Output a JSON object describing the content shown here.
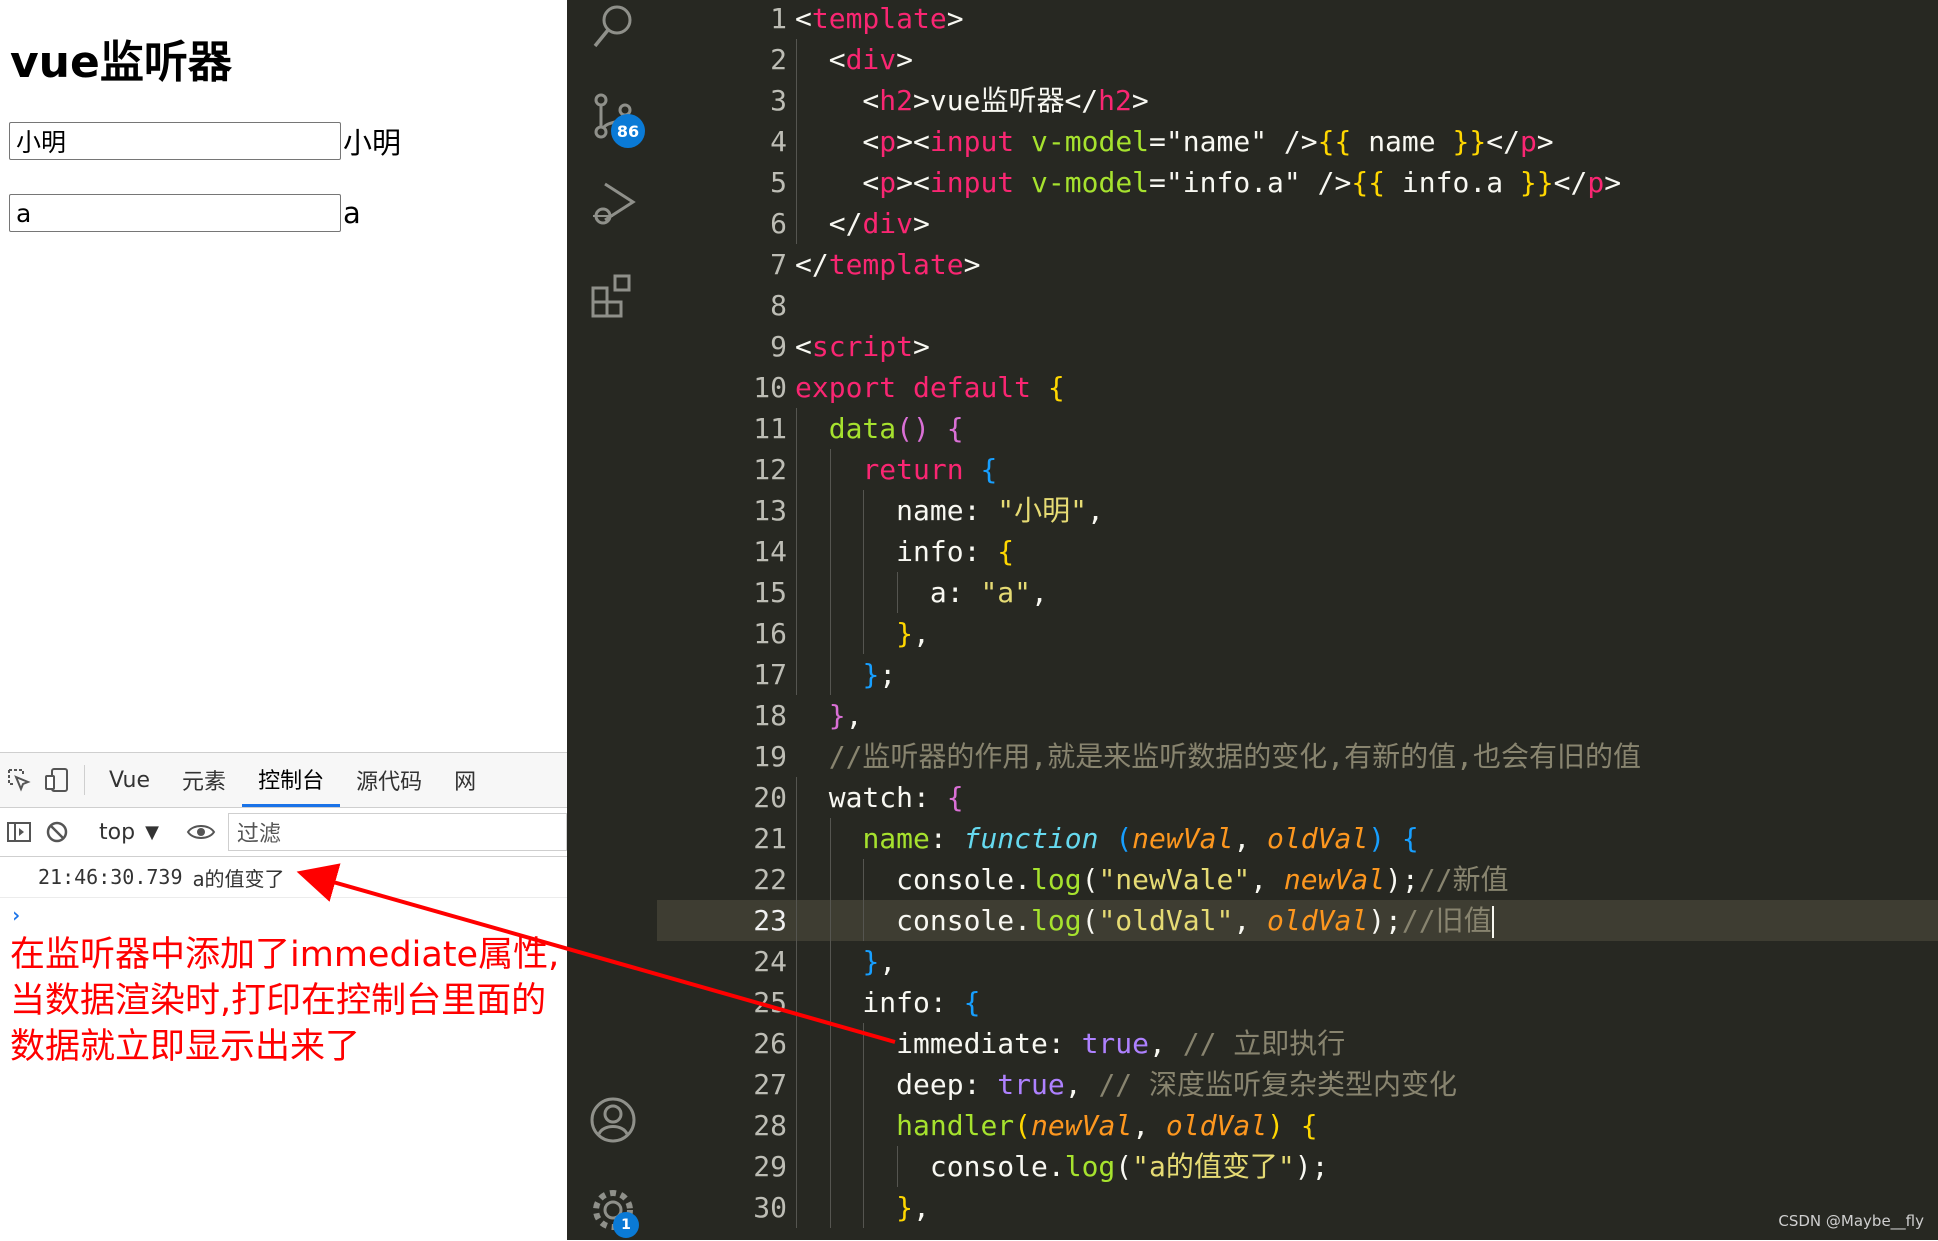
{
  "browser": {
    "heading": "vue监听器",
    "field1": {
      "value": "小明",
      "echo": "小明"
    },
    "field2": {
      "value": "a",
      "echo": "a"
    }
  },
  "devtools": {
    "tabs": [
      "Vue",
      "元素",
      "控制台",
      "源代码",
      "网"
    ],
    "active_tab": "控制台",
    "context": "top",
    "filter_placeholder": "过滤",
    "log": {
      "time": "21:46:30.739",
      "message": "a的值变了"
    },
    "prompt": "›"
  },
  "annotation": [
    "在监听器中添加了immediate属性,",
    "当数据渲染时,打印在控制台里面的",
    "数据就立即显示出来了"
  ],
  "vscode": {
    "scm_badge": "86",
    "settings_badge": "1",
    "current_line": 23,
    "lines": [
      [
        [
          "<",
          "t-punc"
        ],
        [
          "template",
          "t-tag"
        ],
        [
          ">",
          "t-punc"
        ]
      ],
      [
        [
          "  <",
          "t-punc"
        ],
        [
          "div",
          "t-tag"
        ],
        [
          ">",
          "t-punc"
        ]
      ],
      [
        [
          "    <",
          "t-punc"
        ],
        [
          "h2",
          "t-tag"
        ],
        [
          ">vue监听器</",
          "t-punc"
        ],
        [
          "h2",
          "t-tag"
        ],
        [
          ">",
          "t-punc"
        ]
      ],
      [
        [
          "    <",
          "t-punc"
        ],
        [
          "p",
          "t-tag"
        ],
        [
          "><",
          "t-punc"
        ],
        [
          "input",
          "t-tag"
        ],
        [
          " ",
          "t-punc"
        ],
        [
          "v-model",
          "t-fn"
        ],
        [
          "=\"name\" />",
          "t-punc"
        ],
        [
          "{{",
          "t-brace-y"
        ],
        [
          " name ",
          "t-punc"
        ],
        [
          "}}",
          "t-brace-y"
        ],
        [
          "</",
          "t-punc"
        ],
        [
          "p",
          "t-tag"
        ],
        [
          ">",
          "t-punc"
        ]
      ],
      [
        [
          "    <",
          "t-punc"
        ],
        [
          "p",
          "t-tag"
        ],
        [
          "><",
          "t-punc"
        ],
        [
          "input",
          "t-tag"
        ],
        [
          " ",
          "t-punc"
        ],
        [
          "v-model",
          "t-fn"
        ],
        [
          "=\"info.a\" />",
          "t-punc"
        ],
        [
          "{{",
          "t-brace-y"
        ],
        [
          " info.a ",
          "t-punc"
        ],
        [
          "}}",
          "t-brace-y"
        ],
        [
          "</",
          "t-punc"
        ],
        [
          "p",
          "t-tag"
        ],
        [
          ">",
          "t-punc"
        ]
      ],
      [
        [
          "  </",
          "t-punc"
        ],
        [
          "div",
          "t-tag"
        ],
        [
          ">",
          "t-punc"
        ]
      ],
      [
        [
          "</",
          "t-punc"
        ],
        [
          "template",
          "t-tag"
        ],
        [
          ">",
          "t-punc"
        ]
      ],
      [],
      [
        [
          "<",
          "t-punc"
        ],
        [
          "script",
          "t-tag"
        ],
        [
          ">",
          "t-punc"
        ]
      ],
      [
        [
          "export",
          "t-kw"
        ],
        [
          " ",
          "t-punc"
        ],
        [
          "default",
          "t-kw"
        ],
        [
          " ",
          "t-punc"
        ],
        [
          "{",
          "t-brace-y"
        ]
      ],
      [
        [
          "  ",
          "t-punc"
        ],
        [
          "data",
          "t-fn"
        ],
        [
          "()",
          "t-brace-p"
        ],
        [
          " ",
          "t-punc"
        ],
        [
          "{",
          "t-brace-p"
        ]
      ],
      [
        [
          "    ",
          "t-punc"
        ],
        [
          "return",
          "t-kw"
        ],
        [
          " ",
          "t-punc"
        ],
        [
          "{",
          "t-brace-b"
        ]
      ],
      [
        [
          "      name: ",
          "t-punc"
        ],
        [
          "\"小明\"",
          "t-str"
        ],
        [
          ",",
          "t-punc"
        ]
      ],
      [
        [
          "      info: ",
          "t-punc"
        ],
        [
          "{",
          "t-brace-y"
        ]
      ],
      [
        [
          "        a: ",
          "t-punc"
        ],
        [
          "\"a\"",
          "t-str"
        ],
        [
          ",",
          "t-punc"
        ]
      ],
      [
        [
          "      ",
          "t-punc"
        ],
        [
          "}",
          "t-brace-y"
        ],
        [
          ",",
          "t-punc"
        ]
      ],
      [
        [
          "    ",
          "t-punc"
        ],
        [
          "}",
          "t-brace-b"
        ],
        [
          ";",
          "t-punc"
        ]
      ],
      [
        [
          "  ",
          "t-punc"
        ],
        [
          "}",
          "t-brace-p"
        ],
        [
          ",",
          "t-punc"
        ]
      ],
      [
        [
          "  //监听器的作用,就是来监听数据的变化,有新的值,也会有旧的值",
          "t-cm"
        ]
      ],
      [
        [
          "  watch: ",
          "t-punc"
        ],
        [
          "{",
          "t-brace-p"
        ]
      ],
      [
        [
          "    ",
          "t-punc"
        ],
        [
          "name",
          "t-fn"
        ],
        [
          ": ",
          "t-punc"
        ],
        [
          "function",
          "t-stor"
        ],
        [
          " ",
          "t-punc"
        ],
        [
          "(",
          "t-brace-b"
        ],
        [
          "newVal",
          "t-param"
        ],
        [
          ", ",
          "t-punc"
        ],
        [
          "oldVal",
          "t-param"
        ],
        [
          ")",
          "t-brace-b"
        ],
        [
          " ",
          "t-punc"
        ],
        [
          "{",
          "t-brace-b"
        ]
      ],
      [
        [
          "      console.",
          "t-punc"
        ],
        [
          "log",
          "t-fn"
        ],
        [
          "(",
          "t-punc"
        ],
        [
          "\"newVale\"",
          "t-str"
        ],
        [
          ", ",
          "t-punc"
        ],
        [
          "newVal",
          "t-param"
        ],
        [
          ");",
          "t-punc"
        ],
        [
          "//新值",
          "t-cm"
        ]
      ],
      [
        [
          "      console.",
          "t-punc"
        ],
        [
          "log",
          "t-fn"
        ],
        [
          "(",
          "t-punc"
        ],
        [
          "\"oldVal\"",
          "t-str"
        ],
        [
          ", ",
          "t-punc"
        ],
        [
          "oldVal",
          "t-param"
        ],
        [
          ");",
          "t-punc"
        ],
        [
          "//旧值",
          "t-cm"
        ]
      ],
      [
        [
          "    ",
          "t-punc"
        ],
        [
          "}",
          "t-brace-b"
        ],
        [
          ",",
          "t-punc"
        ]
      ],
      [
        [
          "    info: ",
          "t-punc"
        ],
        [
          "{",
          "t-brace-b"
        ]
      ],
      [
        [
          "      immediate: ",
          "t-punc"
        ],
        [
          "true",
          "t-bool"
        ],
        [
          ", ",
          "t-punc"
        ],
        [
          "// 立即执行",
          "t-cm"
        ]
      ],
      [
        [
          "      deep: ",
          "t-punc"
        ],
        [
          "true",
          "t-bool"
        ],
        [
          ", ",
          "t-punc"
        ],
        [
          "// 深度监听复杂类型内变化",
          "t-cm"
        ]
      ],
      [
        [
          "      ",
          "t-punc"
        ],
        [
          "handler",
          "t-fn"
        ],
        [
          "(",
          "t-brace-y"
        ],
        [
          "newVal",
          "t-param"
        ],
        [
          ", ",
          "t-punc"
        ],
        [
          "oldVal",
          "t-param"
        ],
        [
          ")",
          "t-brace-y"
        ],
        [
          " ",
          "t-punc"
        ],
        [
          "{",
          "t-brace-y"
        ]
      ],
      [
        [
          "        console.",
          "t-punc"
        ],
        [
          "log",
          "t-fn"
        ],
        [
          "(",
          "t-punc"
        ],
        [
          "\"a的值变了\"",
          "t-str"
        ],
        [
          ");",
          "t-punc"
        ]
      ],
      [
        [
          "      ",
          "t-punc"
        ],
        [
          "}",
          "t-brace-y"
        ],
        [
          ",",
          "t-punc"
        ]
      ]
    ]
  },
  "watermark": "CSDN @Maybe__fly",
  "colors": {
    "editor_bg": "#272822",
    "accent": "#1a73e8",
    "annotation": "#ff0000",
    "badge": "#0a7ad6"
  }
}
